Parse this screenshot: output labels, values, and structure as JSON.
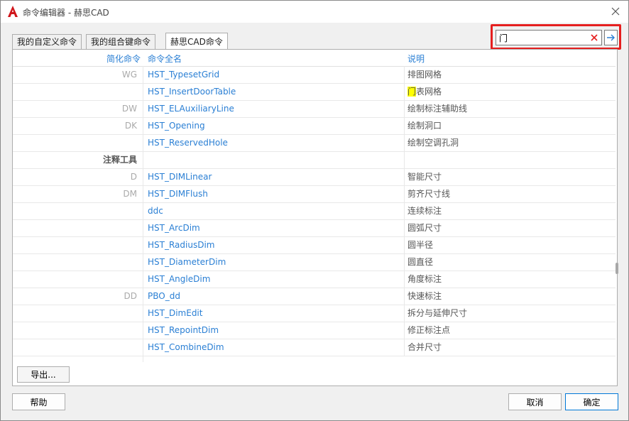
{
  "window": {
    "title": "命令编辑器 - 赫思CAD"
  },
  "tabs": [
    {
      "label": "我的自定义命令",
      "active": false
    },
    {
      "label": "我的组合键命令",
      "active": false
    },
    {
      "label": "赫思CAD命令",
      "active": true
    }
  ],
  "search": {
    "value": "门"
  },
  "table": {
    "headers": [
      "简化命令",
      "命令全名",
      "说明"
    ],
    "rows": [
      {
        "short": "WG",
        "full": "HST_TypesetGrid",
        "desc": "排图网格"
      },
      {
        "short": "",
        "full": "HST_InsertDoorTable",
        "desc_hl": "门",
        "desc": "表网格"
      },
      {
        "short": "DW",
        "full": "HST_ELAuxiliaryLine",
        "desc": "绘制标注辅助线"
      },
      {
        "short": "DK",
        "full": "HST_Opening",
        "desc": "绘制洞口"
      },
      {
        "short": "",
        "full": "HST_ReservedHole",
        "desc": "绘制空调孔洞"
      },
      {
        "group": "注释工具"
      },
      {
        "short": "D",
        "full": "HST_DIMLinear",
        "desc": "智能尺寸"
      },
      {
        "short": "DM",
        "full": "HST_DIMFlush",
        "desc": "剪齐尺寸线"
      },
      {
        "short": "",
        "full": "ddc",
        "desc": "连续标注"
      },
      {
        "short": "",
        "full": "HST_ArcDim",
        "desc": "圆弧尺寸"
      },
      {
        "short": "",
        "full": "HST_RadiusDim",
        "desc": "圆半径"
      },
      {
        "short": "",
        "full": "HST_DiameterDim",
        "desc": "圆直径"
      },
      {
        "short": "",
        "full": "HST_AngleDim",
        "desc": "角度标注"
      },
      {
        "short": "DD",
        "full": "PBO_dd",
        "desc": "快速标注"
      },
      {
        "short": "",
        "full": "HST_DimEdit",
        "desc": "拆分与延伸尺寸"
      },
      {
        "short": "",
        "full": "HST_RepointDim",
        "desc": "修正标注点"
      },
      {
        "short": "",
        "full": "HST_CombineDim",
        "desc": "合并尺寸"
      }
    ]
  },
  "buttons": {
    "export": "导出...",
    "help": "帮助",
    "cancel": "取消",
    "ok": "确定"
  },
  "colors": {
    "link": "#2a7fd4",
    "highlight_border": "#e51f1f",
    "search_match": "#ffff00"
  },
  "icons": [
    "autocad-logo-icon",
    "close-icon",
    "clear-search-icon",
    "arrow-right-icon"
  ]
}
